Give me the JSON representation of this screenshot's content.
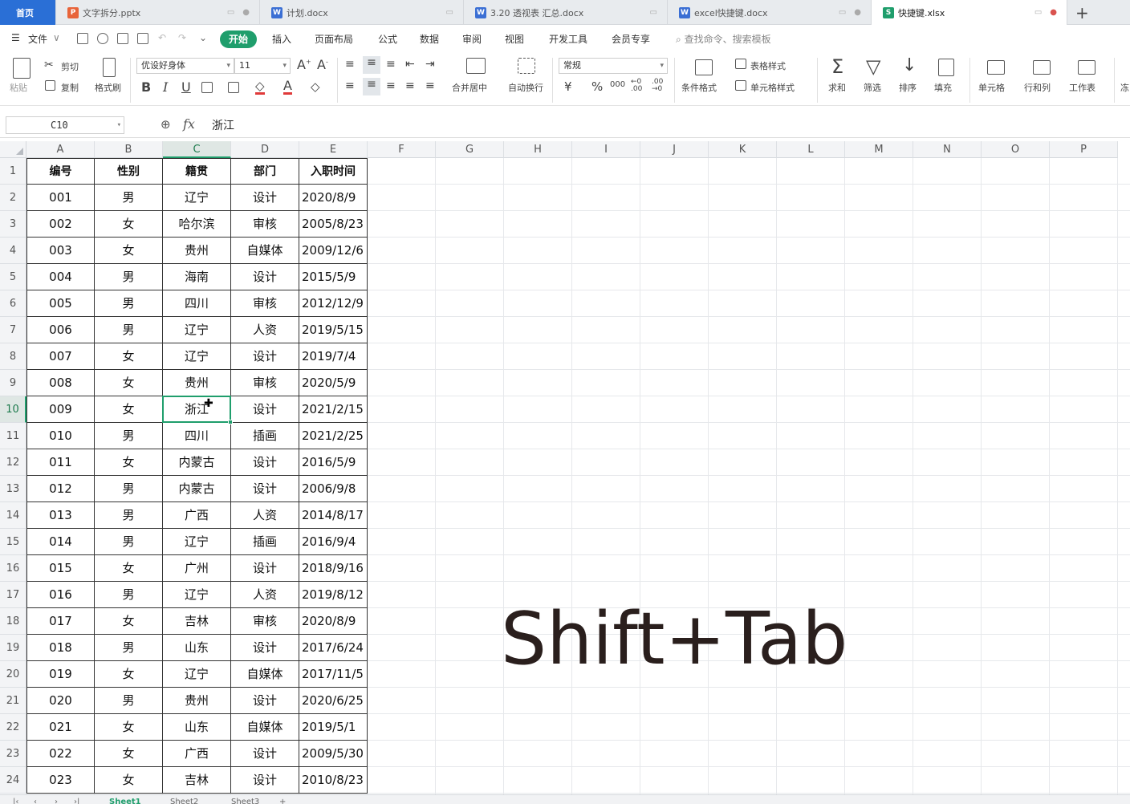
{
  "tabs": [
    {
      "label": "首页",
      "kind": "home"
    },
    {
      "label": "文字拆分.pptx",
      "icon": "P",
      "color": "#e8643a"
    },
    {
      "label": "计划.docx",
      "icon": "W",
      "color": "#3b6fd4"
    },
    {
      "label": "3.20 透视表 汇总.docx",
      "icon": "W",
      "color": "#3b6fd4"
    },
    {
      "label": "excel快捷键.docx",
      "icon": "W",
      "color": "#3b6fd4"
    },
    {
      "label": "快捷键.xlsx",
      "icon": "S",
      "color": "#1f9e6c",
      "active": true
    }
  ],
  "menu": {
    "file": "文件",
    "items": [
      "开始",
      "插入",
      "页面布局",
      "公式",
      "数据",
      "审阅",
      "视图",
      "开发工具",
      "会员专享"
    ],
    "search_placeholder": "查找命令、搜索模板"
  },
  "ribbon": {
    "paste": "粘贴",
    "cut": "剪切",
    "copy": "复制",
    "format_painter": "格式刷",
    "font_name": "优设好身体",
    "font_size": "11",
    "bold": "B",
    "italic": "I",
    "underline": "U",
    "merge_center": "合并居中",
    "wrap_text": "自动换行",
    "number_format": "常规",
    "currency": "¥",
    "percent": "%",
    "thousands": "000",
    "dec_inc": "←0 .00",
    "dec_dec": ".00 →0",
    "cond_format": "条件格式",
    "table_style": "表格样式",
    "cell_style": "单元格样式",
    "sum": "求和",
    "filter": "筛选",
    "sort": "排序",
    "fill": "填充",
    "cell": "单元格",
    "row_col": "行和列",
    "worksheet": "工作表",
    "freeze": "冻"
  },
  "formula_bar": {
    "name_box": "C10",
    "fx": "fx",
    "value": "浙江"
  },
  "columns": [
    "A",
    "B",
    "C",
    "D",
    "E",
    "F",
    "G",
    "H",
    "I",
    "J",
    "K",
    "L",
    "M",
    "N",
    "O",
    "P"
  ],
  "active_cell": "C10",
  "table_header": [
    "编号",
    "性别",
    "籍贯",
    "部门",
    "入职时间"
  ],
  "rows": [
    [
      "001",
      "男",
      "辽宁",
      "设计",
      "2020/8/9"
    ],
    [
      "002",
      "女",
      "哈尔滨",
      "审核",
      "2005/8/23"
    ],
    [
      "003",
      "女",
      "贵州",
      "自媒体",
      "2009/12/6"
    ],
    [
      "004",
      "男",
      "海南",
      "设计",
      "2015/5/9"
    ],
    [
      "005",
      "男",
      "四川",
      "审核",
      "2012/12/9"
    ],
    [
      "006",
      "男",
      "辽宁",
      "人资",
      "2019/5/15"
    ],
    [
      "007",
      "女",
      "辽宁",
      "设计",
      "2019/7/4"
    ],
    [
      "008",
      "女",
      "贵州",
      "审核",
      "2020/5/9"
    ],
    [
      "009",
      "女",
      "浙江",
      "设计",
      "2021/2/15"
    ],
    [
      "010",
      "男",
      "四川",
      "插画",
      "2021/2/25"
    ],
    [
      "011",
      "女",
      "内蒙古",
      "设计",
      "2016/5/9"
    ],
    [
      "012",
      "男",
      "内蒙古",
      "设计",
      "2006/9/8"
    ],
    [
      "013",
      "男",
      "广西",
      "人资",
      "2014/8/17"
    ],
    [
      "014",
      "男",
      "辽宁",
      "插画",
      "2016/9/4"
    ],
    [
      "015",
      "女",
      "广州",
      "设计",
      "2018/9/16"
    ],
    [
      "016",
      "男",
      "辽宁",
      "人资",
      "2019/8/12"
    ],
    [
      "017",
      "女",
      "吉林",
      "审核",
      "2020/8/9"
    ],
    [
      "018",
      "男",
      "山东",
      "设计",
      "2017/6/24"
    ],
    [
      "019",
      "女",
      "辽宁",
      "自媒体",
      "2017/11/5"
    ],
    [
      "020",
      "男",
      "贵州",
      "设计",
      "2020/6/25"
    ],
    [
      "021",
      "女",
      "山东",
      "自媒体",
      "2019/5/1"
    ],
    [
      "022",
      "女",
      "广西",
      "设计",
      "2009/5/30"
    ],
    [
      "023",
      "女",
      "吉林",
      "设计",
      "2010/8/23"
    ]
  ],
  "overlay": "Shift+Tab",
  "sheets": [
    "Sheet1",
    "Sheet2",
    "Sheet3"
  ]
}
